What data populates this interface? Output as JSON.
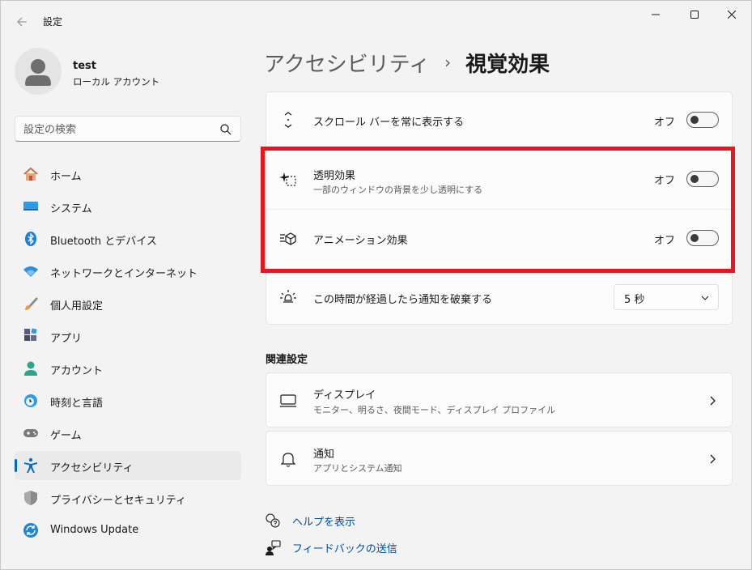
{
  "window": {
    "title": "設定"
  },
  "profile": {
    "name": "test",
    "account_type": "ローカル アカウント"
  },
  "search": {
    "placeholder": "設定の検索"
  },
  "nav": {
    "items": [
      {
        "label": "ホーム",
        "icon": "home-icon"
      },
      {
        "label": "システム",
        "icon": "system-icon"
      },
      {
        "label": "Bluetooth とデバイス",
        "icon": "bluetooth-icon"
      },
      {
        "label": "ネットワークとインターネット",
        "icon": "wifi-icon"
      },
      {
        "label": "個人用設定",
        "icon": "brush-icon"
      },
      {
        "label": "アプリ",
        "icon": "apps-icon"
      },
      {
        "label": "アカウント",
        "icon": "account-icon"
      },
      {
        "label": "時刻と言語",
        "icon": "time-language-icon"
      },
      {
        "label": "ゲーム",
        "icon": "gamepad-icon"
      },
      {
        "label": "アクセシビリティ",
        "icon": "accessibility-icon",
        "active": true
      },
      {
        "label": "プライバシーとセキュリティ",
        "icon": "shield-icon"
      },
      {
        "label": "Windows Update",
        "icon": "update-icon"
      }
    ]
  },
  "breadcrumb": {
    "parent": "アクセシビリティ",
    "separator": "›",
    "current": "視覚効果"
  },
  "settings": {
    "scrollbar": {
      "title": "スクロール バーを常に表示する",
      "state": "オフ",
      "on": false
    },
    "transparency": {
      "title": "透明効果",
      "subtitle": "一部のウィンドウの背景を少し透明にする",
      "state": "オフ",
      "on": false
    },
    "animation": {
      "title": "アニメーション効果",
      "state": "オフ",
      "on": false
    },
    "notification_timeout": {
      "title": "この時間が経過したら通知を破棄する",
      "value": "5 秒"
    }
  },
  "related": {
    "title": "関連設定",
    "display": {
      "title": "ディスプレイ",
      "subtitle": "モニター、明るさ、夜間モード、ディスプレイ プロファイル"
    },
    "notifications": {
      "title": "通知",
      "subtitle": "アプリとシステム通知"
    }
  },
  "links": {
    "help": "ヘルプを表示",
    "feedback": "フィードバックの送信"
  },
  "colors": {
    "accent": "#0067c0",
    "highlight": "#e8141f",
    "link": "#0050a0"
  }
}
